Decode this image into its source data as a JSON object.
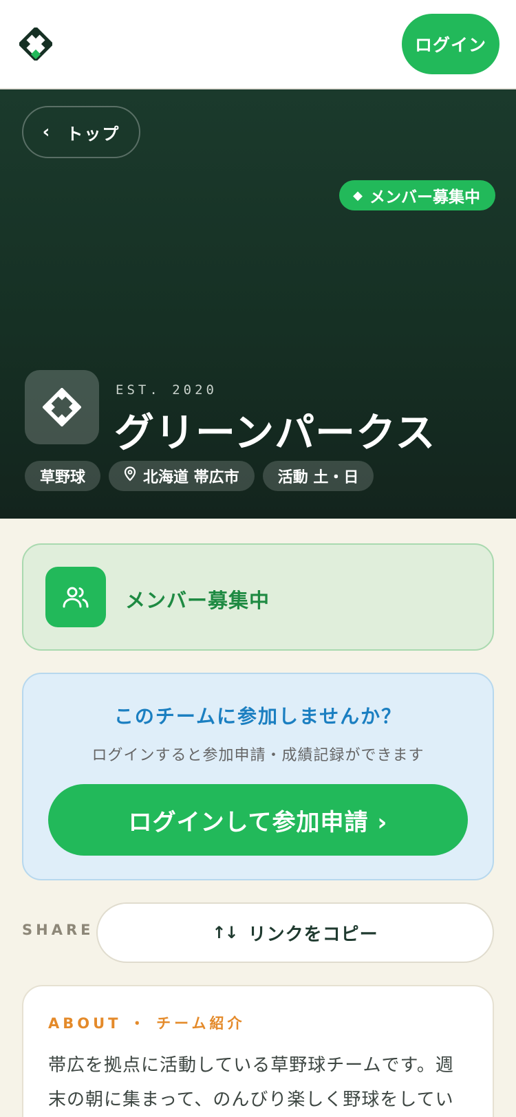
{
  "header": {
    "logo_icon": "diamond-field-logo-icon",
    "login_label": "ログイン"
  },
  "hero": {
    "back_label": "トップ",
    "back_icon": "chevron-left-icon",
    "recruit_badge": "メンバー募集中",
    "est": "EST. 2020",
    "team_name": "グリーンパークス",
    "tags": [
      {
        "label": "草野球"
      },
      {
        "label": "北海道 帯広市",
        "icon": "location-pin-icon"
      },
      {
        "label": "活動 土・日"
      }
    ]
  },
  "recruit_card": {
    "icon": "users-icon",
    "label": "メンバー募集中"
  },
  "join_card": {
    "title": "このチームに参加しませんか？",
    "subtitle": "ログインすると参加申請・成績記録ができます",
    "button_label": "ログインして参加申請 ›"
  },
  "share": {
    "label": "SHARE",
    "copy_label": "リンクをコピー",
    "copy_icon": "swap-arrows-icon"
  },
  "about": {
    "label": "ABOUT ・ チーム紹介",
    "text": "帯広を拠点に活動している草野球チームです。週末の朝に集まって、のんびり楽しく野球をしてい"
  },
  "colors": {
    "accent_green": "#22b95a",
    "hero_dark": "#163024",
    "join_blue": "#1b7fc1",
    "about_orange": "#e48a2a",
    "background": "#f6f3e8"
  }
}
